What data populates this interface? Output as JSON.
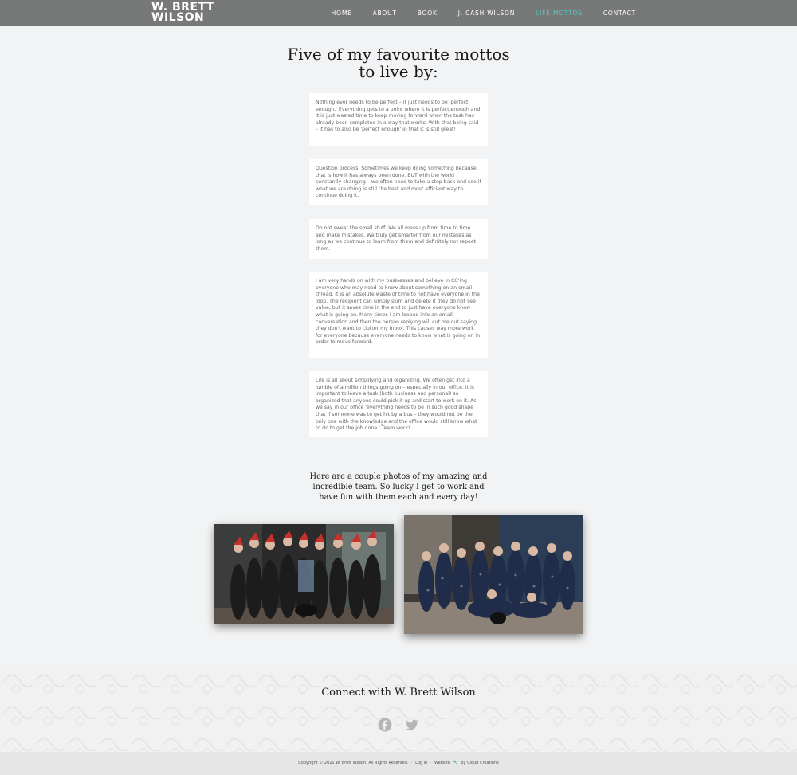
{
  "site": {
    "logo_line1": "W. BRETT",
    "logo_line2": "WILSON"
  },
  "nav": {
    "items": [
      {
        "label": "HOME"
      },
      {
        "label": "ABOUT"
      },
      {
        "label": "BOOK"
      },
      {
        "label": "J. CASH WILSON"
      },
      {
        "label": "LIFE MOTTOS",
        "active": true
      },
      {
        "label": "CONTACT"
      }
    ],
    "active_color": "#56c4cb"
  },
  "page_title": "Five of my favourite mottos to live by:",
  "mottos": [
    {
      "text": "Nothing ever needs to be perfect – it just needs to be 'perfect enough.' Everything gets to a point where it is perfect enough and it is just wasted time to keep moving forward when the task has already been completed in a way that works. With that being said – it has to also be 'perfect enough' in that it is still great!"
    },
    {
      "text": "Question process. Sometimes we keep doing something because that is how it has always been done. BUT with the world constantly changing – we often need to take a step back and see if what we are doing is still the best and most efficient way to continue doing it."
    },
    {
      "text": "Do not sweat the small stuff. We all mess up from time to time and make mistakes. We truly get smarter from our mistakes as long as we continue to learn from them and definitely not repeat them."
    },
    {
      "text": "I am very hands on with my businesses and believe in CC'ing everyone who may need to know about something on an email thread. It is an absolute waste of time to not have everyone in the loop. The recipient can simply skim and delete if they do not see value, but it saves time in the end to just have everyone know what is going on. Many times I am looped into an email conversation and then the person replying will cut me out saying they don't want to clutter my inbox. This causes way more work for everyone because everyone needs to know what is going on in order to move forward."
    },
    {
      "text": "Life is all about simplifying and organizing. We often get into a jumble of a million things going on – especially in our office. It is important to leave a task (both business and personal) so organized that anyone could pick it up and start to work on it. As we say in our office 'everything needs to be in such good shape that if someone was to get hit by a bus – they would not be the only one with the knowledge and the office would still know what to do to get the job done.' Team work!"
    }
  ],
  "photos": {
    "heading": "Here are a couple photos of my amazing and incredible team. So lucky I get to work and have fun with them each and every day!"
  },
  "connect": {
    "title": "Connect with W. Brett Wilson",
    "icons": [
      "facebook-icon",
      "twitter-icon"
    ]
  },
  "footer": {
    "copyright": "Copyright © 2021 W. Brett Wilson. All Rights Reserved.",
    "sep1": "·",
    "login": "Log in",
    "sep2": "·",
    "website_prefix": "Website",
    "by": "by Cloud Creations"
  }
}
